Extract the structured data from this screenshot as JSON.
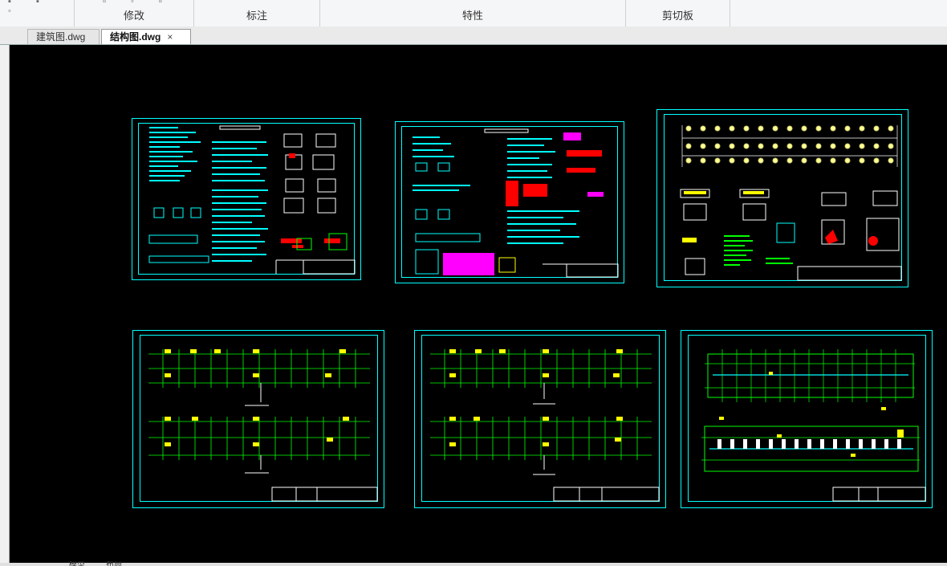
{
  "ribbon": {
    "groups": [
      {
        "label": "修改"
      },
      {
        "label": "标注"
      },
      {
        "label": "特性"
      },
      {
        "label": "剪切板"
      }
    ]
  },
  "tabs": [
    {
      "label": "建筑图.dwg",
      "active": false
    },
    {
      "label": "结构图.dwg",
      "active": true,
      "close": "×"
    }
  ],
  "bottom_tabs": [
    {
      "label": "模型"
    },
    {
      "label": "布局"
    }
  ],
  "colors": {
    "canvas_bg": "#000000",
    "frame": "#00ffff",
    "grid": "#00ff00",
    "annotation": "#ffff00",
    "highlight": "#ff0000",
    "text": "#ffffff"
  },
  "sheets": [
    {
      "name": "structure-notes-1",
      "kind": "notes"
    },
    {
      "name": "structure-notes-2",
      "kind": "notes"
    },
    {
      "name": "foundation-details",
      "kind": "details"
    },
    {
      "name": "floor-plan-1",
      "kind": "plan"
    },
    {
      "name": "floor-plan-2",
      "kind": "plan"
    },
    {
      "name": "roof-plan",
      "kind": "plan"
    }
  ]
}
